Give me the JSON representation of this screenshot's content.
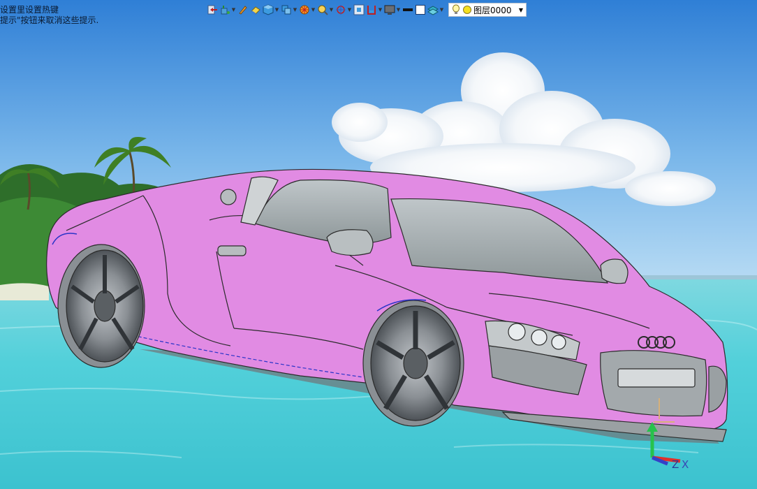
{
  "hint": {
    "line1": "设置里设置热键",
    "line2": "提示\"按钮来取消这些提示."
  },
  "toolbar": {
    "icons": [
      {
        "name": "import-icon",
        "dropdown": false
      },
      {
        "name": "paint-bucket-icon",
        "dropdown": true
      },
      {
        "name": "pencil-icon",
        "dropdown": false
      },
      {
        "name": "eraser-icon",
        "dropdown": false
      },
      {
        "name": "solid-cube-icon",
        "dropdown": true
      },
      {
        "name": "view-cube-icon",
        "dropdown": true
      },
      {
        "name": "render-wheel-icon",
        "dropdown": true
      },
      {
        "name": "zoom-icon",
        "dropdown": true
      },
      {
        "name": "target-icon",
        "dropdown": true
      },
      {
        "name": "fit-view-icon",
        "dropdown": false
      },
      {
        "name": "section-icon",
        "dropdown": true
      },
      {
        "name": "monitor-icon",
        "dropdown": true
      },
      {
        "name": "line-style-icon",
        "dropdown": false
      },
      {
        "name": "frame-icon",
        "dropdown": false
      },
      {
        "name": "layers-icon",
        "dropdown": true
      }
    ],
    "layer": {
      "name": "图层0000",
      "lamp_icon": "lightbulb-icon",
      "color_icon": "yellow-dot-icon",
      "dropdown_icon": "chevron-down-icon"
    }
  },
  "axes": {
    "z_label": "Z",
    "x_label": "X",
    "y_color": "#27c24c",
    "x_color": "#e0312b",
    "z_color": "#3540c8"
  },
  "colors": {
    "car_body": "#e18be3",
    "wheel": "#8a8f94",
    "sky_top": "#2f7fd6",
    "water": "#52d0da"
  }
}
